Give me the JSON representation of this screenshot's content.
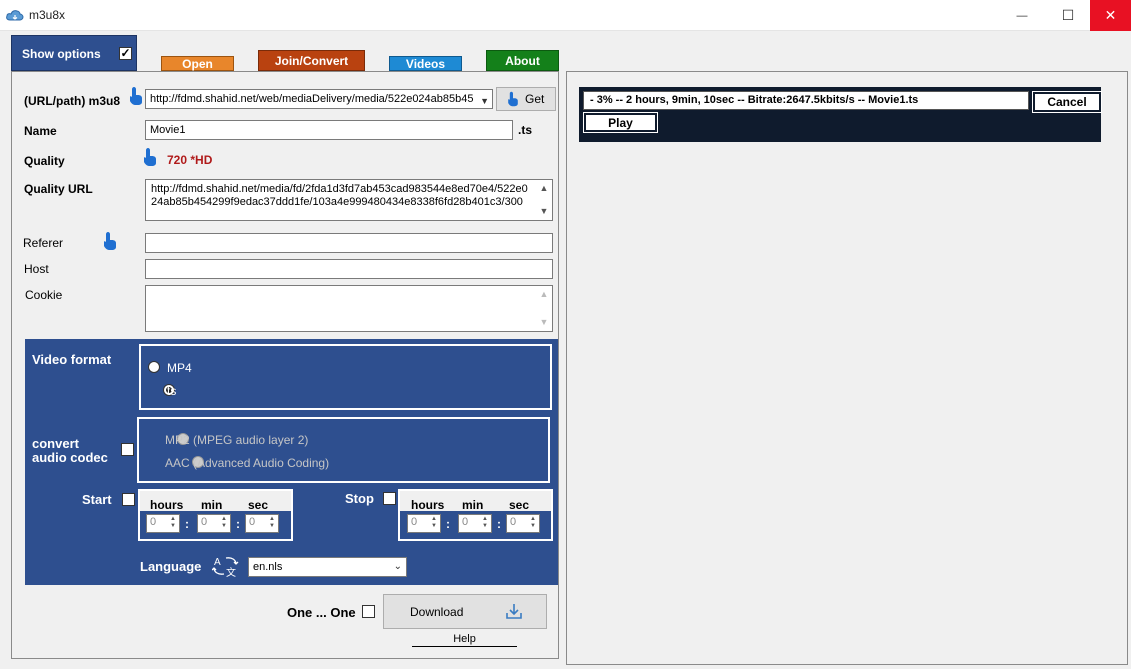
{
  "window": {
    "title": "m3u8x",
    "minimize_glyph": "—",
    "maximize_glyph": "☐",
    "close_glyph": "✕"
  },
  "tabs": {
    "show_options": "Show options",
    "show_options_checked": true,
    "open": "Open",
    "join_convert": "Join/Convert",
    "videos": "Videos",
    "about": "About"
  },
  "form": {
    "url_label": "(URL/path) m3u8",
    "url_value": "http://fdmd.shahid.net/web/mediaDelivery/media/522e024ab85b45",
    "get_button": "Get",
    "name_label": "Name",
    "name_value": "Movie1",
    "name_ext": ".ts",
    "quality_label": "Quality",
    "quality_value": "720 *HD",
    "quality_url_label": "Quality URL",
    "quality_url_value": "http://fdmd.shahid.net/media/fd/2fda1d3fd7ab453cad983544e8ed70e4/522e024ab85b454299f9edac37ddd1fe/103a4e999480434e8338f6fd28b401c3/300",
    "referer_label": "Referer",
    "referer_value": "",
    "host_label": "Host",
    "host_value": "",
    "cookie_label": "Cookie",
    "cookie_value": ""
  },
  "options": {
    "video_format_label": "Video format",
    "video_formats": [
      "MP4",
      "ts"
    ],
    "selected_video_format": "ts",
    "convert_audio_label_line1": "convert",
    "convert_audio_label_line2": "audio codec",
    "audio_codecs": [
      "MP2 (MPEG audio layer 2)",
      "AAC (Advanced Audio Coding)"
    ],
    "start_label": "Start",
    "stop_label": "Stop",
    "hours_label": "hours",
    "min_label": "min",
    "sec_label": "sec",
    "start_values": [
      "0",
      "0",
      "0"
    ],
    "stop_values": [
      "0",
      "0",
      "0"
    ],
    "colon": ":",
    "language_label": "Language",
    "language_value": "en.nls"
  },
  "footer": {
    "one_one_label": "One ... One",
    "download_button": "Download",
    "help_link": "Help"
  },
  "progress": {
    "status_text": "- 3% -- 2 hours, 9min, 10sec -- Bitrate:2647.5kbits/s  -- Movie1.ts",
    "cancel_button": "Cancel",
    "play_button": "Play"
  },
  "icons": {
    "hand_pointer": "hand-pointer-icon",
    "download": "download-arrow-icon",
    "translate": "translate-icon",
    "app": "cloud-icon"
  },
  "colors": {
    "panel_blue": "#2e4f8f",
    "quality_red": "#b01a1a",
    "close_red": "#e81123",
    "progress_dark": "#0f1b2d"
  }
}
